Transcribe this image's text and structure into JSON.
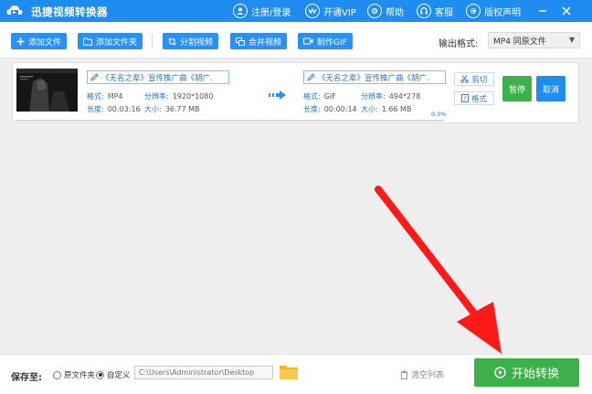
{
  "titlebar": {
    "app_title": "迅捷视频转换器",
    "app_icon": "cloud-logo-icon",
    "links": [
      {
        "label": "注册/登录",
        "icon": "user-icon"
      },
      {
        "label": "开通VIP",
        "icon": "vip-icon"
      },
      {
        "label": "帮助",
        "icon": "help-icon"
      },
      {
        "label": "客服",
        "icon": "headset-icon"
      },
      {
        "label": "版权声明",
        "icon": "copyright-icon"
      }
    ],
    "window_controls": [
      "minimize-icon",
      "close-icon"
    ]
  },
  "toolbar": {
    "add_file": "添加文件",
    "add_folder": "添加文件夹",
    "split_video": "分割视频",
    "merge_video": "合并视频",
    "make_gif": "制作GIF",
    "output_format_label": "输出格式:",
    "output_format_value": "MP4  同原文件"
  },
  "task": {
    "source": {
      "name": "《无名之辈》宣传推广曲《胡广.",
      "format_label": "格式:",
      "format": "MP4",
      "resolution_label": "分辨率:",
      "resolution": "1920*1080",
      "duration_label": "长度:",
      "duration": "00:03:16",
      "size_label": "大小:",
      "size": "36.77 MB"
    },
    "target": {
      "name": "《无名之辈》宣传推广曲《胡广.",
      "format_label": "格式:",
      "format": "GIF",
      "resolution_label": "分辨率:",
      "resolution": "494*278",
      "duration_label": "长度:",
      "duration": "00:00:14",
      "size_label": "大小:",
      "size": "1.66 MB"
    },
    "cut_label": "剪切",
    "format_btn_label": "格式",
    "pause_label": "暂停",
    "cancel_label": "取消",
    "progress_text": "0.0%",
    "progress_fraction": 0.0
  },
  "bottombar": {
    "save_to_label": "保存至:",
    "option_original": "原文件夹",
    "option_custom": "自定义",
    "selected_option": "custom",
    "path_placeholder": "C:\\Users\\Administrator\\Desktop",
    "clear_list_label": "清空列表",
    "start_label": "开始转换"
  },
  "colors": {
    "titlebar": "#1e8cf0",
    "toolbar_button": "#2a8ff7",
    "start_button": "#3db04a",
    "annotation_arrow": "#ff1a1a"
  }
}
